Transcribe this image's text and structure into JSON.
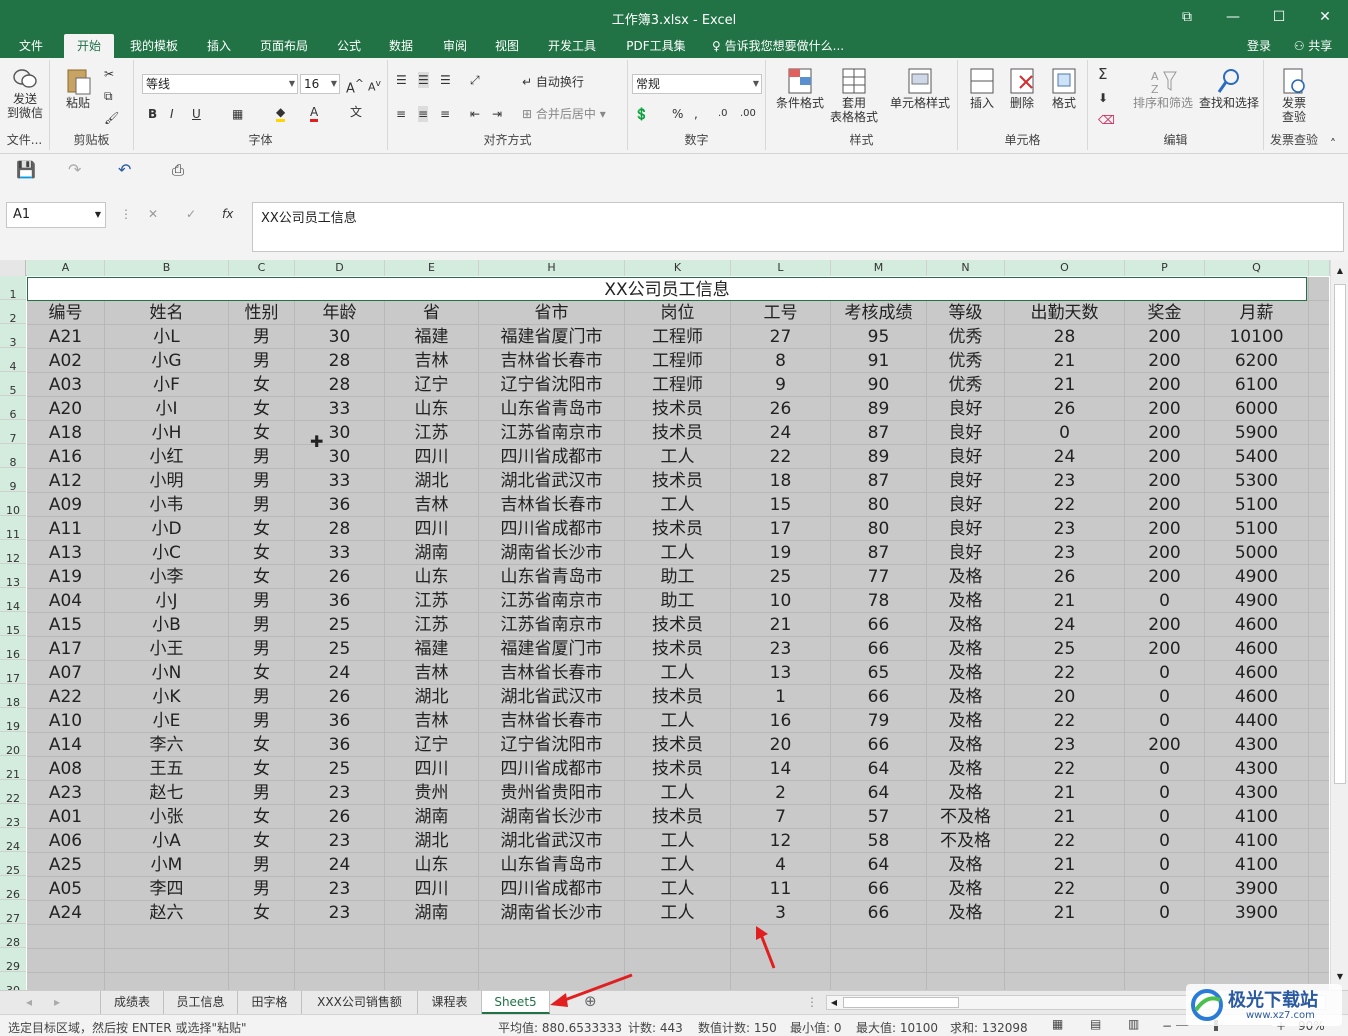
{
  "window": {
    "title": "工作簿3.xlsx - Excel"
  },
  "menu": {
    "tabs": [
      "文件",
      "开始",
      "我的模板",
      "插入",
      "页面布局",
      "公式",
      "数据",
      "审阅",
      "视图",
      "开发工具",
      "PDF工具集"
    ],
    "tell_me": "告诉我您想要做什么...",
    "login": "登录",
    "share": "共享"
  },
  "ribbon": {
    "wechat": {
      "label1": "发送",
      "label2": "到微信",
      "group": "文件..."
    },
    "clipboard": {
      "paste": "粘贴",
      "group": "剪贴板"
    },
    "font": {
      "name": "等线",
      "size": "16",
      "group": "字体",
      "bold": "B",
      "italic": "I",
      "underline": "U"
    },
    "align": {
      "wrap": "自动换行",
      "merge": "合并后居中",
      "group": "对齐方式"
    },
    "number": {
      "format": "常规",
      "group": "数字",
      "percent": "%"
    },
    "styles": {
      "cond": "条件格式",
      "table1": "套用",
      "table2": "表格格式",
      "cellstyle": "单元格样式",
      "group": "样式"
    },
    "cells": {
      "insert": "插入",
      "delete": "删除",
      "format": "格式",
      "group": "单元格"
    },
    "editing": {
      "sort": "排序和筛选",
      "find": "查找和选择",
      "group": "编辑"
    },
    "invoice": {
      "label1": "发票",
      "label2": "查验",
      "group": "发票查验"
    }
  },
  "formula": {
    "namebox": "A1",
    "fx": "fx",
    "content": "XX公司员工信息"
  },
  "columns": [
    "A",
    "B",
    "C",
    "D",
    "E",
    "H",
    "K",
    "L",
    "M",
    "N",
    "O",
    "P",
    "Q"
  ],
  "sheet_title": "XX公司员工信息",
  "headers": [
    "编号",
    "姓名",
    "性别",
    "年龄",
    "省",
    "省市",
    "岗位",
    "工号",
    "考核成绩",
    "等级",
    "出勤天数",
    "奖金",
    "月薪"
  ],
  "rows": [
    [
      "A21",
      "小L",
      "男",
      "30",
      "福建",
      "福建省厦门市",
      "工程师",
      "27",
      "95",
      "优秀",
      "28",
      "200",
      "10100"
    ],
    [
      "A02",
      "小G",
      "男",
      "28",
      "吉林",
      "吉林省长春市",
      "工程师",
      "8",
      "91",
      "优秀",
      "21",
      "200",
      "6200"
    ],
    [
      "A03",
      "小F",
      "女",
      "28",
      "辽宁",
      "辽宁省沈阳市",
      "工程师",
      "9",
      "90",
      "优秀",
      "21",
      "200",
      "6100"
    ],
    [
      "A20",
      "小I",
      "女",
      "33",
      "山东",
      "山东省青岛市",
      "技术员",
      "26",
      "89",
      "良好",
      "26",
      "200",
      "6000"
    ],
    [
      "A18",
      "小H",
      "女",
      "30",
      "江苏",
      "江苏省南京市",
      "技术员",
      "24",
      "87",
      "良好",
      "0",
      "200",
      "5900"
    ],
    [
      "A16",
      "小红",
      "男",
      "30",
      "四川",
      "四川省成都市",
      "工人",
      "22",
      "89",
      "良好",
      "24",
      "200",
      "5400"
    ],
    [
      "A12",
      "小明",
      "男",
      "33",
      "湖北",
      "湖北省武汉市",
      "技术员",
      "18",
      "87",
      "良好",
      "23",
      "200",
      "5300"
    ],
    [
      "A09",
      "小韦",
      "男",
      "36",
      "吉林",
      "吉林省长春市",
      "工人",
      "15",
      "80",
      "良好",
      "22",
      "200",
      "5100"
    ],
    [
      "A11",
      "小D",
      "女",
      "28",
      "四川",
      "四川省成都市",
      "技术员",
      "17",
      "80",
      "良好",
      "23",
      "200",
      "5100"
    ],
    [
      "A13",
      "小C",
      "女",
      "33",
      "湖南",
      "湖南省长沙市",
      "工人",
      "19",
      "87",
      "良好",
      "23",
      "200",
      "5000"
    ],
    [
      "A19",
      "小李",
      "女",
      "26",
      "山东",
      "山东省青岛市",
      "助工",
      "25",
      "77",
      "及格",
      "26",
      "200",
      "4900"
    ],
    [
      "A04",
      "小J",
      "男",
      "36",
      "江苏",
      "江苏省南京市",
      "助工",
      "10",
      "78",
      "及格",
      "21",
      "0",
      "4900"
    ],
    [
      "A15",
      "小B",
      "男",
      "25",
      "江苏",
      "江苏省南京市",
      "技术员",
      "21",
      "66",
      "及格",
      "24",
      "200",
      "4600"
    ],
    [
      "A17",
      "小王",
      "男",
      "25",
      "福建",
      "福建省厦门市",
      "技术员",
      "23",
      "66",
      "及格",
      "25",
      "200",
      "4600"
    ],
    [
      "A07",
      "小N",
      "女",
      "24",
      "吉林",
      "吉林省长春市",
      "工人",
      "13",
      "65",
      "及格",
      "22",
      "0",
      "4600"
    ],
    [
      "A22",
      "小K",
      "男",
      "26",
      "湖北",
      "湖北省武汉市",
      "技术员",
      "1",
      "66",
      "及格",
      "20",
      "0",
      "4600"
    ],
    [
      "A10",
      "小E",
      "男",
      "36",
      "吉林",
      "吉林省长春市",
      "工人",
      "16",
      "79",
      "及格",
      "22",
      "0",
      "4400"
    ],
    [
      "A14",
      "李六",
      "女",
      "36",
      "辽宁",
      "辽宁省沈阳市",
      "技术员",
      "20",
      "66",
      "及格",
      "23",
      "200",
      "4300"
    ],
    [
      "A08",
      "王五",
      "女",
      "25",
      "四川",
      "四川省成都市",
      "技术员",
      "14",
      "64",
      "及格",
      "22",
      "0",
      "4300"
    ],
    [
      "A23",
      "赵七",
      "男",
      "23",
      "贵州",
      "贵州省贵阳市",
      "工人",
      "2",
      "64",
      "及格",
      "21",
      "0",
      "4300"
    ],
    [
      "A01",
      "小张",
      "女",
      "26",
      "湖南",
      "湖南省长沙市",
      "技术员",
      "7",
      "57",
      "不及格",
      "21",
      "0",
      "4100"
    ],
    [
      "A06",
      "小A",
      "女",
      "23",
      "湖北",
      "湖北省武汉市",
      "工人",
      "12",
      "58",
      "不及格",
      "22",
      "0",
      "4100"
    ],
    [
      "A25",
      "小M",
      "男",
      "24",
      "山东",
      "山东省青岛市",
      "工人",
      "4",
      "64",
      "及格",
      "21",
      "0",
      "4100"
    ],
    [
      "A05",
      "李四",
      "男",
      "23",
      "四川",
      "四川省成都市",
      "工人",
      "11",
      "66",
      "及格",
      "22",
      "0",
      "3900"
    ],
    [
      "A24",
      "赵六",
      "女",
      "23",
      "湖南",
      "湖南省长沙市",
      "工人",
      "3",
      "66",
      "及格",
      "21",
      "0",
      "3900"
    ]
  ],
  "row_numbers": [
    "1",
    "2",
    "3",
    "4",
    "5",
    "6",
    "7",
    "8",
    "9",
    "10",
    "11",
    "12",
    "13",
    "14",
    "15",
    "16",
    "17",
    "18",
    "19",
    "20",
    "21",
    "22",
    "23",
    "24",
    "25",
    "26",
    "27",
    "28",
    "29",
    "30"
  ],
  "sheets": [
    "成绩表",
    "员工信息",
    "田字格",
    "XXX公司销售额",
    "课程表",
    "Sheet5"
  ],
  "active_sheet": "Sheet5",
  "status": {
    "hint": "选定目标区域，然后按 ENTER 或选择\"粘贴\"",
    "avg": "平均值: 880.6533333",
    "count": "计数: 443",
    "numcount": "数值计数: 150",
    "min": "最小值: 0",
    "max": "最大值: 10100",
    "sum": "求和: 132098",
    "zoom": "90%"
  },
  "watermark": {
    "text1": "极光下载站",
    "text2": "www.xz7.com"
  },
  "colors": {
    "excel_green": "#217346",
    "selection_gray": "#c9c9c9",
    "arrow_red": "#e02020"
  }
}
